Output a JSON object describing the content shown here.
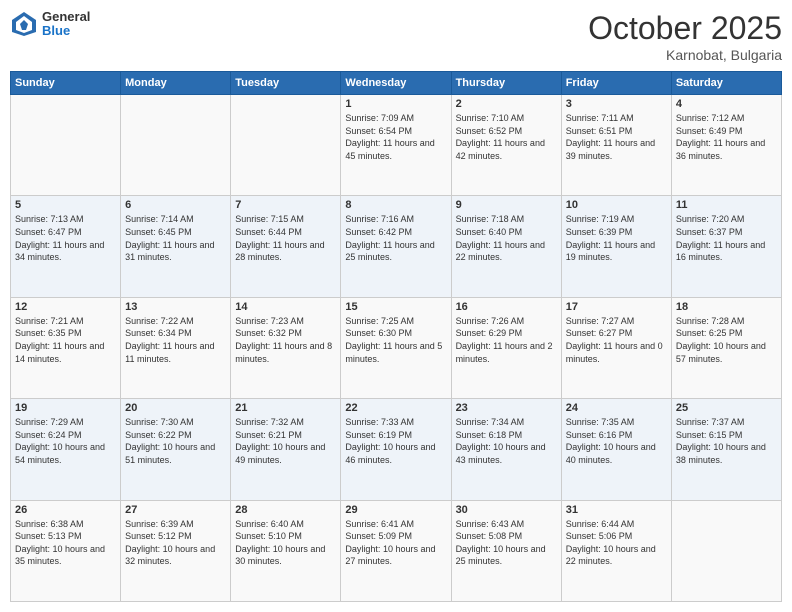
{
  "header": {
    "logo": {
      "general": "General",
      "blue": "Blue"
    },
    "title": "October 2025",
    "subtitle": "Karnobat, Bulgaria"
  },
  "calendar": {
    "days_of_week": [
      "Sunday",
      "Monday",
      "Tuesday",
      "Wednesday",
      "Thursday",
      "Friday",
      "Saturday"
    ],
    "weeks": [
      [
        {
          "day": "",
          "info": ""
        },
        {
          "day": "",
          "info": ""
        },
        {
          "day": "",
          "info": ""
        },
        {
          "day": "1",
          "info": "Sunrise: 7:09 AM\nSunset: 6:54 PM\nDaylight: 11 hours and 45 minutes."
        },
        {
          "day": "2",
          "info": "Sunrise: 7:10 AM\nSunset: 6:52 PM\nDaylight: 11 hours and 42 minutes."
        },
        {
          "day": "3",
          "info": "Sunrise: 7:11 AM\nSunset: 6:51 PM\nDaylight: 11 hours and 39 minutes."
        },
        {
          "day": "4",
          "info": "Sunrise: 7:12 AM\nSunset: 6:49 PM\nDaylight: 11 hours and 36 minutes."
        }
      ],
      [
        {
          "day": "5",
          "info": "Sunrise: 7:13 AM\nSunset: 6:47 PM\nDaylight: 11 hours and 34 minutes."
        },
        {
          "day": "6",
          "info": "Sunrise: 7:14 AM\nSunset: 6:45 PM\nDaylight: 11 hours and 31 minutes."
        },
        {
          "day": "7",
          "info": "Sunrise: 7:15 AM\nSunset: 6:44 PM\nDaylight: 11 hours and 28 minutes."
        },
        {
          "day": "8",
          "info": "Sunrise: 7:16 AM\nSunset: 6:42 PM\nDaylight: 11 hours and 25 minutes."
        },
        {
          "day": "9",
          "info": "Sunrise: 7:18 AM\nSunset: 6:40 PM\nDaylight: 11 hours and 22 minutes."
        },
        {
          "day": "10",
          "info": "Sunrise: 7:19 AM\nSunset: 6:39 PM\nDaylight: 11 hours and 19 minutes."
        },
        {
          "day": "11",
          "info": "Sunrise: 7:20 AM\nSunset: 6:37 PM\nDaylight: 11 hours and 16 minutes."
        }
      ],
      [
        {
          "day": "12",
          "info": "Sunrise: 7:21 AM\nSunset: 6:35 PM\nDaylight: 11 hours and 14 minutes."
        },
        {
          "day": "13",
          "info": "Sunrise: 7:22 AM\nSunset: 6:34 PM\nDaylight: 11 hours and 11 minutes."
        },
        {
          "day": "14",
          "info": "Sunrise: 7:23 AM\nSunset: 6:32 PM\nDaylight: 11 hours and 8 minutes."
        },
        {
          "day": "15",
          "info": "Sunrise: 7:25 AM\nSunset: 6:30 PM\nDaylight: 11 hours and 5 minutes."
        },
        {
          "day": "16",
          "info": "Sunrise: 7:26 AM\nSunset: 6:29 PM\nDaylight: 11 hours and 2 minutes."
        },
        {
          "day": "17",
          "info": "Sunrise: 7:27 AM\nSunset: 6:27 PM\nDaylight: 11 hours and 0 minutes."
        },
        {
          "day": "18",
          "info": "Sunrise: 7:28 AM\nSunset: 6:25 PM\nDaylight: 10 hours and 57 minutes."
        }
      ],
      [
        {
          "day": "19",
          "info": "Sunrise: 7:29 AM\nSunset: 6:24 PM\nDaylight: 10 hours and 54 minutes."
        },
        {
          "day": "20",
          "info": "Sunrise: 7:30 AM\nSunset: 6:22 PM\nDaylight: 10 hours and 51 minutes."
        },
        {
          "day": "21",
          "info": "Sunrise: 7:32 AM\nSunset: 6:21 PM\nDaylight: 10 hours and 49 minutes."
        },
        {
          "day": "22",
          "info": "Sunrise: 7:33 AM\nSunset: 6:19 PM\nDaylight: 10 hours and 46 minutes."
        },
        {
          "day": "23",
          "info": "Sunrise: 7:34 AM\nSunset: 6:18 PM\nDaylight: 10 hours and 43 minutes."
        },
        {
          "day": "24",
          "info": "Sunrise: 7:35 AM\nSunset: 6:16 PM\nDaylight: 10 hours and 40 minutes."
        },
        {
          "day": "25",
          "info": "Sunrise: 7:37 AM\nSunset: 6:15 PM\nDaylight: 10 hours and 38 minutes."
        }
      ],
      [
        {
          "day": "26",
          "info": "Sunrise: 6:38 AM\nSunset: 5:13 PM\nDaylight: 10 hours and 35 minutes."
        },
        {
          "day": "27",
          "info": "Sunrise: 6:39 AM\nSunset: 5:12 PM\nDaylight: 10 hours and 32 minutes."
        },
        {
          "day": "28",
          "info": "Sunrise: 6:40 AM\nSunset: 5:10 PM\nDaylight: 10 hours and 30 minutes."
        },
        {
          "day": "29",
          "info": "Sunrise: 6:41 AM\nSunset: 5:09 PM\nDaylight: 10 hours and 27 minutes."
        },
        {
          "day": "30",
          "info": "Sunrise: 6:43 AM\nSunset: 5:08 PM\nDaylight: 10 hours and 25 minutes."
        },
        {
          "day": "31",
          "info": "Sunrise: 6:44 AM\nSunset: 5:06 PM\nDaylight: 10 hours and 22 minutes."
        },
        {
          "day": "",
          "info": ""
        }
      ]
    ]
  }
}
